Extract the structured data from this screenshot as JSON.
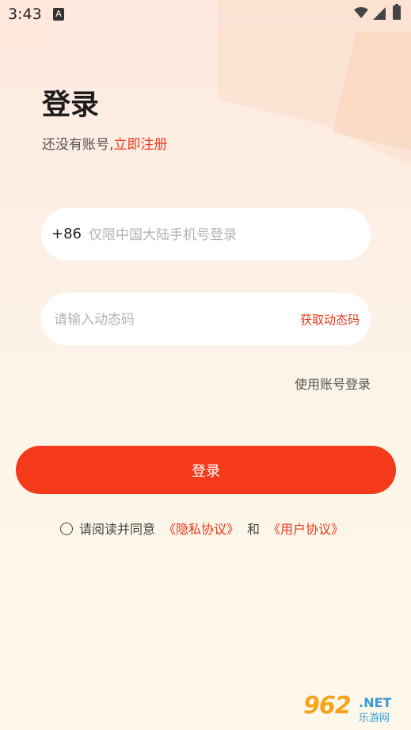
{
  "status_bar": {
    "time": "3:43",
    "notification_glyph": "A"
  },
  "header": {
    "title": "登录",
    "subtitle_prefix": "还没有账号,",
    "register_link": "立即注册"
  },
  "phone_field": {
    "country_code": "+86",
    "value": "",
    "placeholder": "仅限中国大陆手机号登录"
  },
  "code_field": {
    "value": "",
    "placeholder": "请输入动态码",
    "get_code_label": "获取动态码"
  },
  "account_login_link": "使用账号登录",
  "login_button_label": "登录",
  "agreement": {
    "text": "请阅读并同意",
    "privacy_link": "《隐私协议》",
    "connector": "和",
    "user_link": "《用户协议》",
    "checked": false
  },
  "watermark": {
    "number": "962",
    "net": ".NET",
    "sub": "乐游网"
  },
  "colors": {
    "accent": "#f53a1c",
    "link": "#e53a1e"
  },
  "icons": [
    "notification-icon",
    "wifi-icon",
    "signal-icon",
    "battery-icon",
    "checkbox-circle-icon"
  ]
}
